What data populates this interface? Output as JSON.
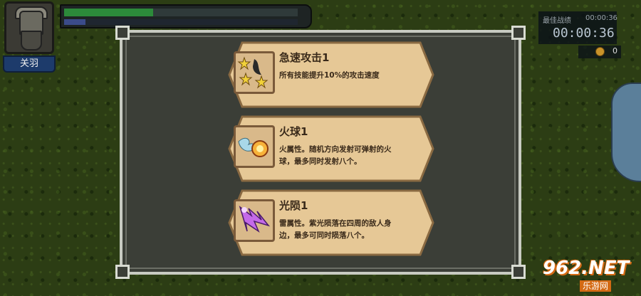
{
  "hero": {
    "name": "关羽",
    "hp_fraction": 0.38,
    "xp_fraction": 0.09
  },
  "timer": {
    "best_label": "最佳战绩",
    "best_value": "00:00:36",
    "current": "00:00:36"
  },
  "coins": {
    "value": "0"
  },
  "upgrades": [
    {
      "title": "急速攻击1",
      "desc": "所有技能提升10%的攻击速度",
      "icon": "speed-stars-icon"
    },
    {
      "title": "火球1",
      "desc": "火属性。随机方向发射可弹射的火球，最多同时发射八个。",
      "icon": "fireball-icon"
    },
    {
      "title": "光陨1",
      "desc": "雷属性。紫光陨落在四周的敌人身边，最多可同时陨落八个。",
      "icon": "purple-meteor-icon"
    }
  ],
  "watermark": {
    "main": "962.NET",
    "sub": "乐游网"
  },
  "colors": {
    "card_parchment": "#e6c896",
    "card_border": "#8a6a42",
    "hp": "#2c8a3a",
    "xp": "#3b4b8a"
  }
}
